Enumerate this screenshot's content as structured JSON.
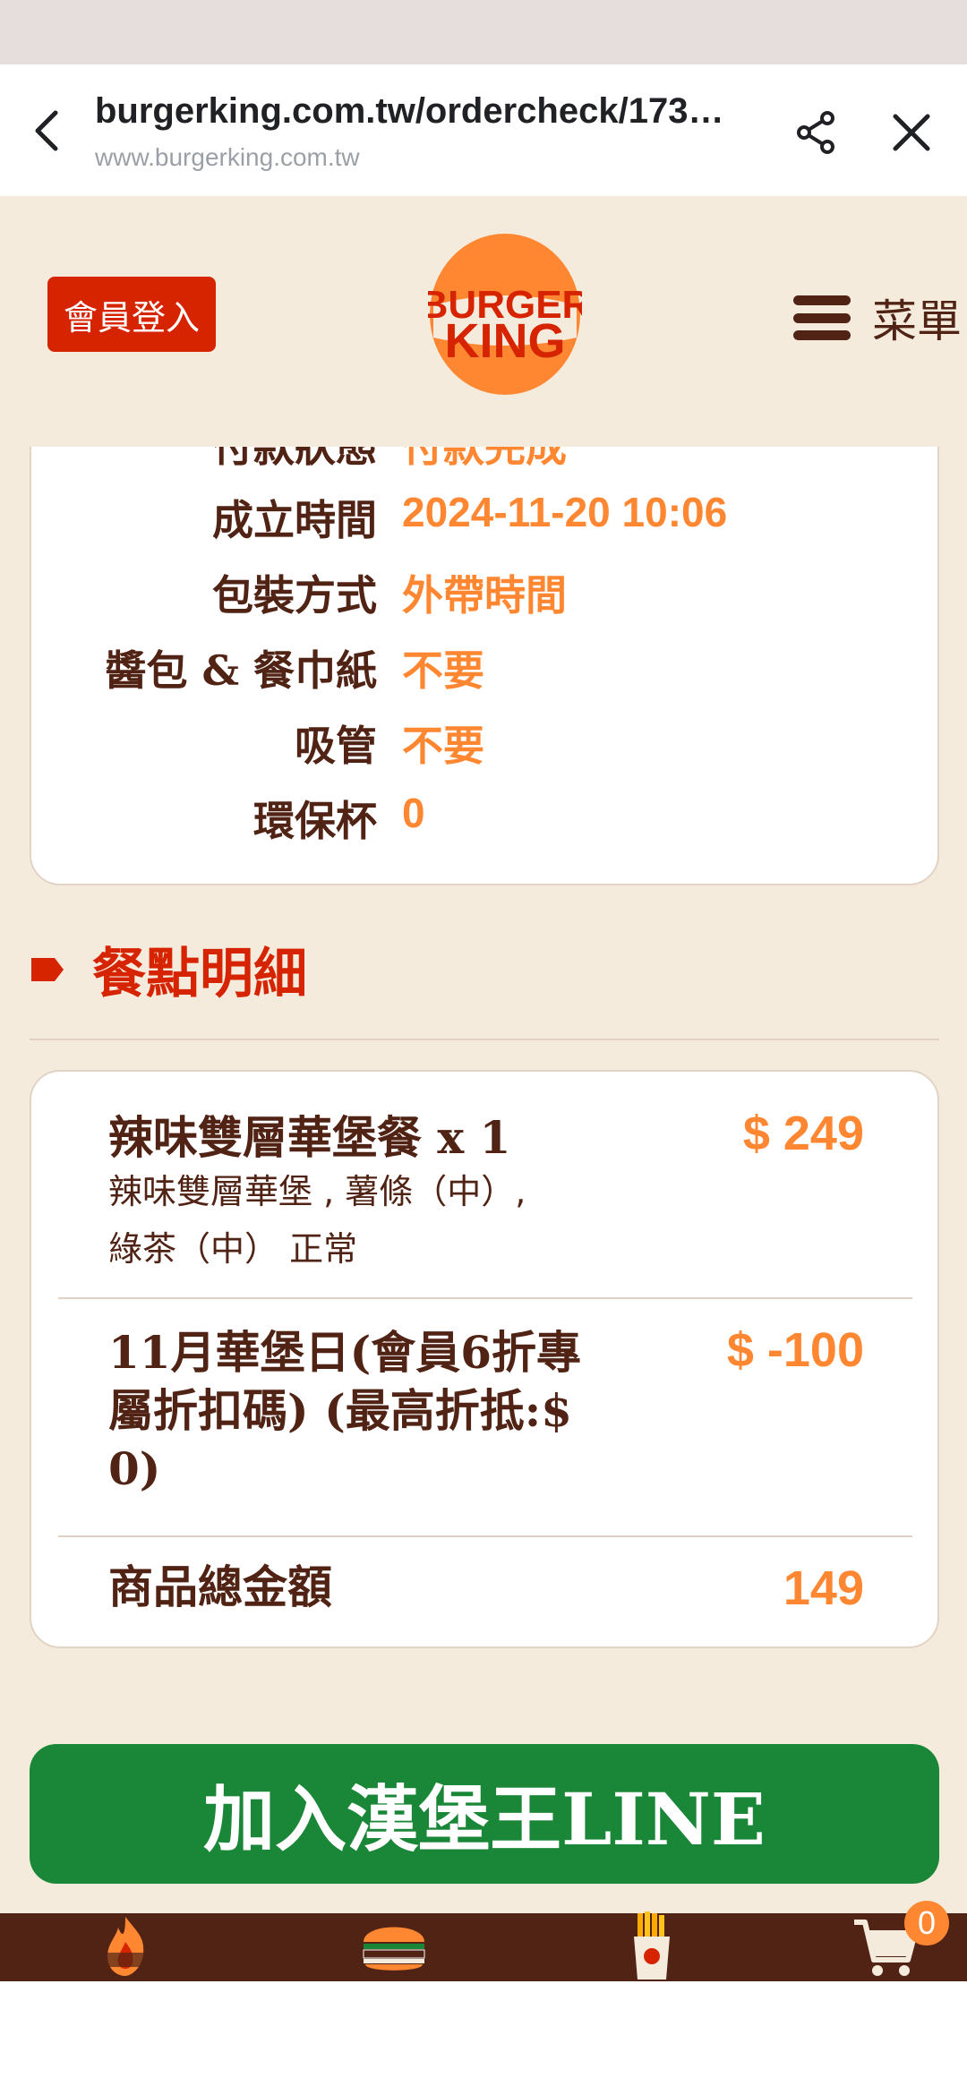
{
  "browser": {
    "url": "burgerking.com.tw/ordercheck/173…",
    "domain": "www.burgerking.com.tw"
  },
  "header": {
    "login_label": "會員登入",
    "logo_line1": "BURGER",
    "logo_line2": "KING",
    "menu_label": "菜單"
  },
  "order_info": {
    "rows": [
      {
        "label": "付款狀態",
        "value": "付款完成"
      },
      {
        "label": "成立時間",
        "value": "2024-11-20 10:06"
      },
      {
        "label": "包裝方式",
        "value": "外帶時間"
      },
      {
        "label": "醬包 & 餐巾紙",
        "value": "不要"
      },
      {
        "label": "吸管",
        "value": "不要"
      },
      {
        "label": "環保杯",
        "value": "0"
      }
    ]
  },
  "details": {
    "title": "餐點明細",
    "items": [
      {
        "name": "辣味雙層華堡餐 x 1",
        "desc_line1": "辣味雙層華堡 , 薯條（中）,",
        "desc_line2": "綠茶（中） 正常",
        "price": "$ 249"
      },
      {
        "name_line1": "11月華堡日(會員6折專",
        "name_line2": "屬折扣碼) (最高折抵:$",
        "name_line3": "0)",
        "price": "$ -100"
      }
    ],
    "total_label": "商品總金額",
    "total_value": "149"
  },
  "line_button": "加入漢堡王LINE",
  "bottom_nav": {
    "cart_count": "0",
    "icons": [
      "flame-grill-icon",
      "burger-icon",
      "fries-icon",
      "cart-icon"
    ]
  },
  "colors": {
    "brand_red": "#d62300",
    "brand_orange": "#ff8732",
    "brand_brown": "#502314",
    "line_green": "#198737",
    "page_bg": "#f4ebdd"
  }
}
